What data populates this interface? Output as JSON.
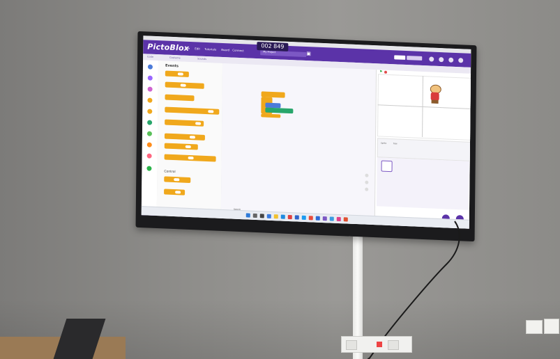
{
  "app": {
    "logo": "PictoBlox",
    "menu": [
      "File",
      "Edit",
      "Tutorials",
      "Board",
      "Connect"
    ],
    "join_code": "002 849",
    "project_label": "My Project",
    "tabs": [
      "Code",
      "Costume",
      "Sounds"
    ],
    "palette_section": "Events",
    "control_section": "Control",
    "stage_info": [
      "Sprite",
      "Tobi"
    ],
    "taskbar_search": "Search"
  },
  "colors": {
    "accent": "#5b33a8",
    "block_events": "#f0a81c",
    "block_control": "#f0a81c",
    "block_motion": "#4c7bd9",
    "block_sensing": "#28a66b",
    "wall": "#8f8e8b"
  },
  "icons": [
    "green-flag-icon",
    "stop-icon",
    "save-icon",
    "search-icon",
    "windows-start-icon"
  ]
}
